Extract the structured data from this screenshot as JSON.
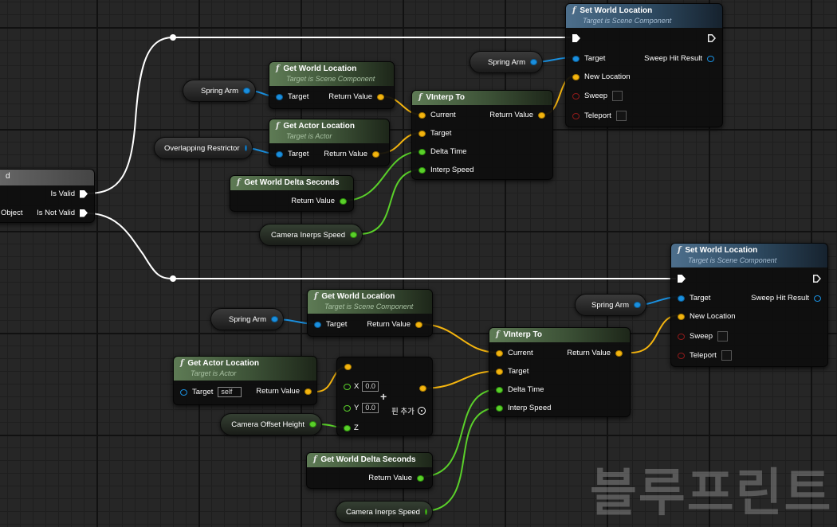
{
  "editor": "Blueprint",
  "watermark": "블루프린트",
  "colors": {
    "object_pin": "#1a8fde",
    "vector_pin": "#f3b40f",
    "float_pin": "#5ad02a",
    "bool_pin": "#8e1a1a",
    "exec_wire": "#ffffff"
  },
  "is_valid_node": {
    "pins_out": [
      "Is Valid",
      "Is Not Valid"
    ],
    "partial_title": "d",
    "partial_input": "Object"
  },
  "variables": {
    "spring_arm_1": "Spring Arm",
    "spring_arm_2": "Spring Arm",
    "spring_arm_3": "Spring Arm",
    "spring_arm_4": "Spring Arm",
    "overlapping_restrictor": "Overlapping Restrictor",
    "camera_inerps_speed_1": "Camera Inerps Speed",
    "camera_inerps_speed_2": "Camera Inerps Speed",
    "camera_offset_height": "Camera Offset Height"
  },
  "get_world_location_1": {
    "title": "Get World Location",
    "subtitle": "Target is Scene Component",
    "in": "Target",
    "out": "Return Value"
  },
  "get_actor_location_1": {
    "title": "Get Actor Location",
    "subtitle": "Target is Actor",
    "in": "Target",
    "out": "Return Value"
  },
  "get_world_delta_1": {
    "title": "Get World Delta Seconds",
    "out": "Return Value"
  },
  "vinterp_1": {
    "title": "VInterp To",
    "inputs": [
      "Current",
      "Target",
      "Delta Time",
      "Interp Speed"
    ],
    "out": "Return Value"
  },
  "set_world_location_1": {
    "title": "Set World Location",
    "subtitle": "Target is Scene Component",
    "inputs": [
      "Target",
      "New Location",
      "Sweep",
      "Teleport"
    ],
    "out": "Sweep Hit Result"
  },
  "get_world_location_2": {
    "title": "Get World Location",
    "subtitle": "Target is Scene Component",
    "in": "Target",
    "out": "Return Value"
  },
  "get_actor_location_2": {
    "title": "Get Actor Location",
    "subtitle": "Target is Actor",
    "in": "Target",
    "in_value": "self",
    "out": "Return Value"
  },
  "make_vector": {
    "x_label": "X",
    "x_value": "0.0",
    "y_label": "Y",
    "y_value": "0.0",
    "z_label": "Z",
    "add_pin": "핀 추가"
  },
  "get_world_delta_2": {
    "title": "Get World Delta Seconds",
    "out": "Return Value"
  },
  "vinterp_2": {
    "title": "VInterp To",
    "inputs": [
      "Current",
      "Target",
      "Delta Time",
      "Interp Speed"
    ],
    "out": "Return Value"
  },
  "set_world_location_2": {
    "title": "Set World Location",
    "subtitle": "Target is Scene Component",
    "inputs": [
      "Target",
      "New Location",
      "Sweep",
      "Teleport"
    ],
    "out": "Sweep Hit Result"
  }
}
